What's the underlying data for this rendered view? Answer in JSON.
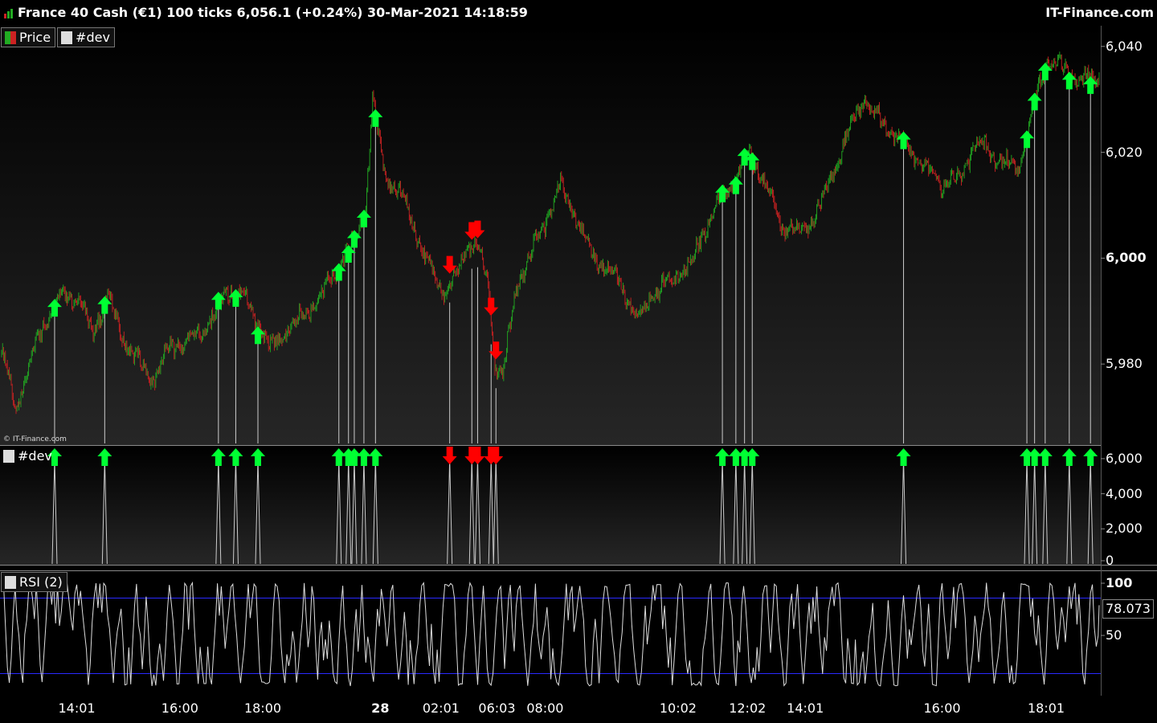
{
  "header": {
    "title": "France 40 Cash (€1) 100 ticks 6,056.1 (+0.24%) 30-Mar-2021 14:18:59",
    "brand": "IT-Finance.com",
    "logo_icon": "bar-chart-icon"
  },
  "colors": {
    "background": "#000000",
    "candle_up": "#22aa22",
    "candle_down": "#cc2222",
    "arrow_up": "#00ff33",
    "arrow_down": "#ff0000",
    "rsi_line": "#dddddd",
    "rsi_levels": "#2a2aff",
    "dev_line": "#cccccc"
  },
  "legends": {
    "price_label": "Price",
    "dev_label": "#dev",
    "dev_panel_label": "#dev",
    "rsi_label": "RSI (2)"
  },
  "copyright": "© IT-Finance.com",
  "rsi_value": "78.073",
  "chart_data": [
    {
      "type": "candlestick",
      "panel": "price",
      "title": "France 40 Cash (€1) 100 ticks",
      "ylim": [
        5965,
        6043
      ],
      "y_ticks": [
        "6,040",
        "6,020",
        "6,000",
        "5,980"
      ],
      "x_tick_labels": [
        "14:01",
        "16:00",
        "18:00",
        "28",
        "02:01",
        "06:03",
        "08:00",
        "10:02",
        "12:02",
        "14:01",
        "16:00",
        "18:01"
      ],
      "x_tick_bar_index": [
        78,
        185,
        271,
        393,
        456,
        514,
        564,
        702,
        774,
        834,
        976,
        1084
      ],
      "total_bars": 1140,
      "trend": [
        [
          0,
          5982
        ],
        [
          15,
          5972
        ],
        [
          40,
          5986
        ],
        [
          60,
          5993
        ],
        [
          80,
          5992
        ],
        [
          95,
          5986
        ],
        [
          110,
          5993
        ],
        [
          125,
          5985
        ],
        [
          140,
          5981
        ],
        [
          155,
          5977
        ],
        [
          175,
          5983
        ],
        [
          200,
          5985
        ],
        [
          220,
          5989
        ],
        [
          235,
          5994
        ],
        [
          250,
          5993
        ],
        [
          265,
          5988
        ],
        [
          280,
          5983
        ],
        [
          300,
          5987
        ],
        [
          330,
          5992
        ],
        [
          350,
          5999
        ],
        [
          365,
          6003
        ],
        [
          378,
          6010
        ],
        [
          385,
          6030
        ],
        [
          398,
          6016
        ],
        [
          420,
          6010
        ],
        [
          440,
          6000
        ],
        [
          460,
          5993
        ],
        [
          475,
          5998
        ],
        [
          485,
          6003
        ],
        [
          495,
          6002
        ],
        [
          505,
          5995
        ],
        [
          512,
          5980
        ],
        [
          520,
          5978
        ],
        [
          535,
          5995
        ],
        [
          560,
          6005
        ],
        [
          580,
          6014
        ],
        [
          595,
          6008
        ],
        [
          615,
          6000
        ],
        [
          640,
          5996
        ],
        [
          660,
          5988
        ],
        [
          675,
          5993
        ],
        [
          695,
          5996
        ],
        [
          715,
          5999
        ],
        [
          735,
          6008
        ],
        [
          760,
          6015
        ],
        [
          775,
          6020
        ],
        [
          790,
          6015
        ],
        [
          810,
          6006
        ],
        [
          830,
          6005
        ],
        [
          850,
          6010
        ],
        [
          870,
          6020
        ],
        [
          895,
          6030
        ],
        [
          915,
          6025
        ],
        [
          945,
          6020
        ],
        [
          975,
          6014
        ],
        [
          995,
          6015
        ],
        [
          1010,
          6022
        ],
        [
          1040,
          6018
        ],
        [
          1055,
          6017
        ],
        [
          1070,
          6028
        ],
        [
          1085,
          6038
        ],
        [
          1100,
          6036
        ],
        [
          1120,
          6034
        ],
        [
          1140,
          6034
        ]
      ],
      "signals_up_bar": [
        55,
        107,
        225,
        243,
        266,
        350,
        360,
        366,
        376,
        388,
        748,
        762,
        771,
        779,
        936,
        1064,
        1072,
        1083,
        1108,
        1130
      ],
      "signals_down_bar": [
        465,
        488,
        494,
        508,
        513
      ]
    },
    {
      "type": "line",
      "panel": "dev",
      "ylim": [
        0,
        6500
      ],
      "y_ticks": [
        "6,000",
        "4,000",
        "2,000",
        "0"
      ]
    },
    {
      "type": "line",
      "panel": "rsi",
      "title": "RSI (2)",
      "ylim": [
        0,
        100
      ],
      "y_ticks": [
        "100",
        "50"
      ],
      "levels": [
        90,
        10
      ],
      "last_value": 78.073
    }
  ]
}
